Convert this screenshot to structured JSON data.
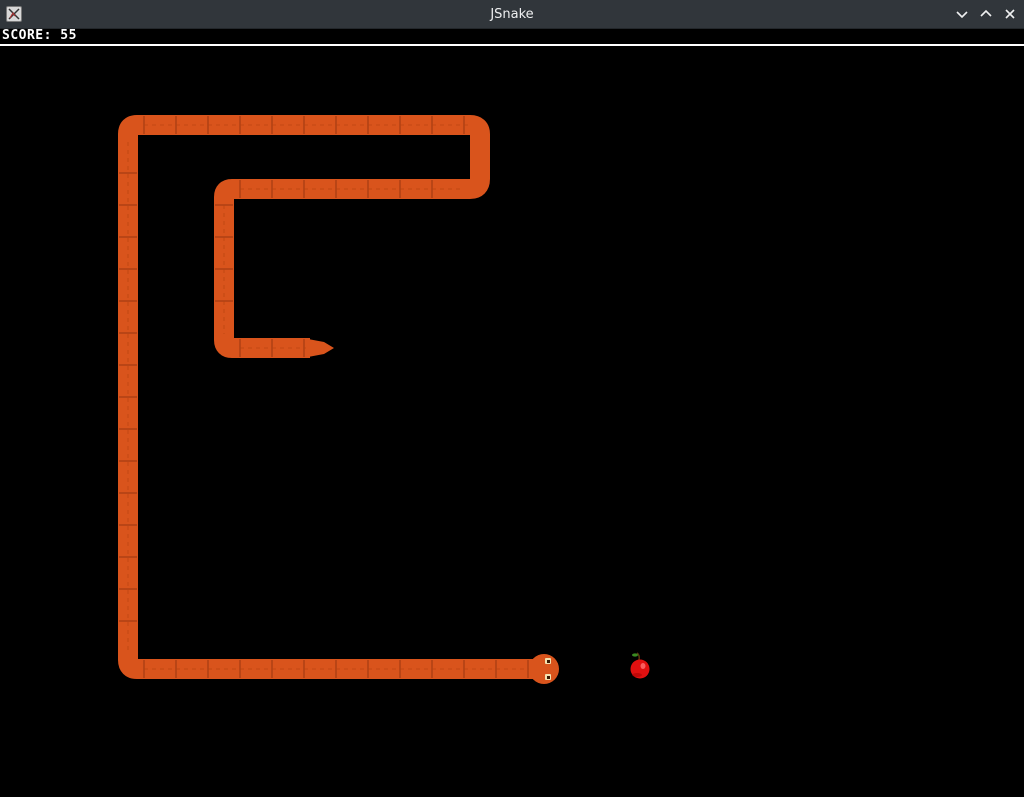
{
  "window": {
    "title": "JSnake",
    "app_icon": "jsnake-app-icon",
    "controls": [
      "minimize",
      "maximize",
      "close"
    ]
  },
  "hud": {
    "score_label": "SCORE:",
    "score_value": "55",
    "score_text": "SCORE: 55"
  },
  "game": {
    "background_color": "#000000",
    "snake_color": "#d9541c",
    "snake_segment_line_color": "#8a2f0c",
    "apple_color": "#e01010",
    "apple_leaf_color": "#3a8a20",
    "snake_direction": "right",
    "food": "apple-icon"
  }
}
